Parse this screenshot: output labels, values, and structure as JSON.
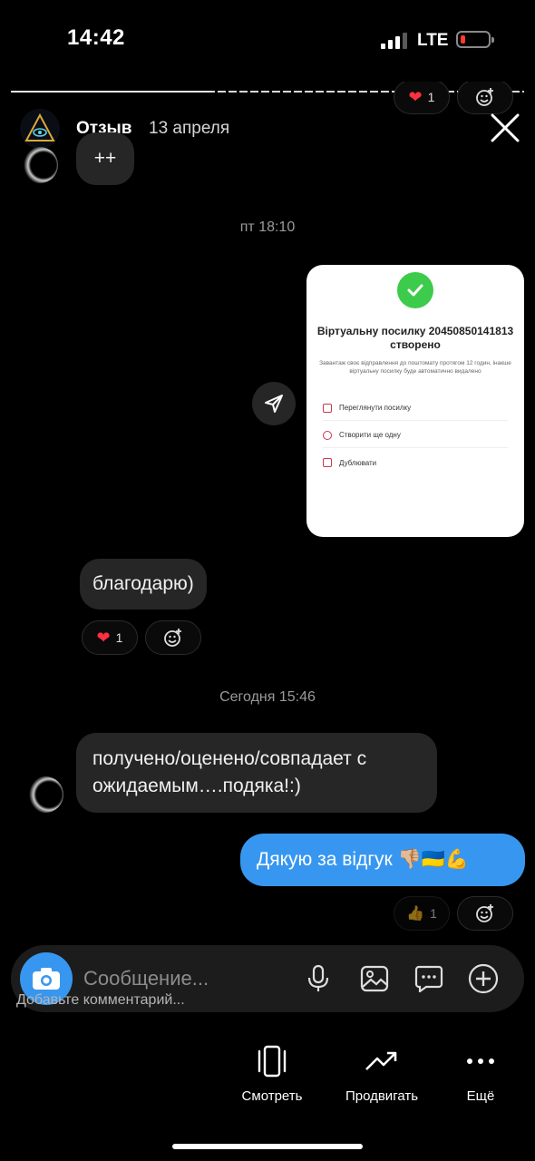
{
  "status_bar": {
    "time": "14:42",
    "network": "LTE"
  },
  "story": {
    "username": "Отзыв",
    "date": "13 апреля"
  },
  "chat": {
    "top_reaction_count": "1",
    "plus_message": "++",
    "timestamp_1": "пт 18:10",
    "screenshot": {
      "title": "Віртуальну посилку 20450850141813 створено",
      "body": "Завантаж своє відправлення до поштомату протягом 12 годин, інакше віртуальну посилку буде автоматично видалено",
      "options": [
        "Переглянути посилку",
        "Створити ще одну",
        "Дублювати"
      ]
    },
    "msg_thanks": "благодарю)",
    "thanks_reaction_count": "1",
    "timestamp_2": "Сегодня 15:46",
    "msg_received": "получено/оценено/совпадает с ожидаемым….подяка!:)",
    "msg_reply": "Дякую за відгук 👎🏼🇺🇦💪",
    "reply_reaction_count": "1"
  },
  "composer": {
    "placeholder": "Сообщение...",
    "comment_hint": "Добавьте комментарий..."
  },
  "actions": {
    "view": "Смотреть",
    "promote": "Продвигать",
    "more": "Ещё"
  },
  "colors": {
    "accent": "#3797f0",
    "bubble_in": "#262626",
    "background": "#000000"
  }
}
